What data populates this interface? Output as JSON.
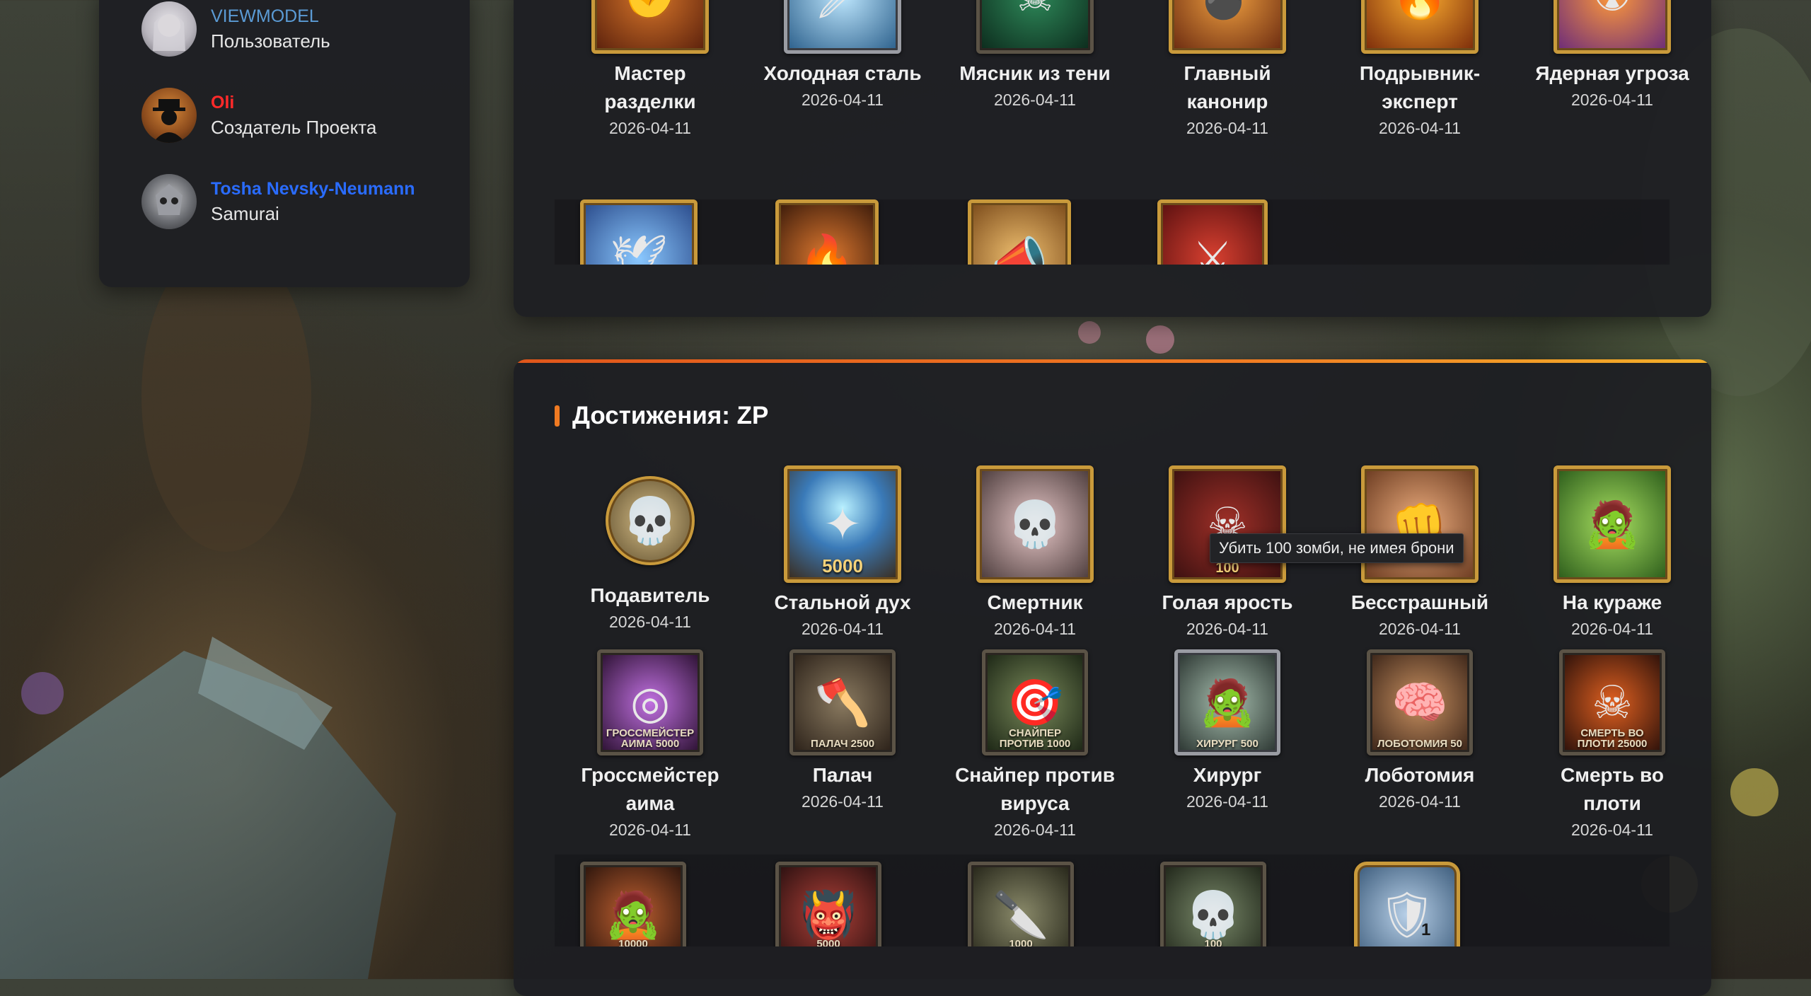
{
  "sidebar": {
    "members": [
      {
        "name": "VIEWMODEL",
        "role": "Пользователь",
        "name_color": "#5b9bd5"
      },
      {
        "name": "Oli",
        "role": "Создатель Проекта",
        "name_color": "#ff2a2a"
      },
      {
        "name": "Tosha Nevsky-Neumann",
        "role": "Samurai",
        "name_color": "#2a6cff"
      }
    ]
  },
  "top_section": {
    "achievements": [
      {
        "name_line1": "Мастер",
        "name_line2": "разделки",
        "date": "2026-04-11",
        "icon": "butcher-fist-icon"
      },
      {
        "name_line1": "Холодная сталь",
        "name_line2": "",
        "date": "2026-04-11",
        "icon": "ice-knife-icon"
      },
      {
        "name_line1": "Мясник из тени",
        "name_line2": "",
        "date": "2026-04-11",
        "icon": "shadow-reaper-icon"
      },
      {
        "name_line1": "Главный",
        "name_line2": "канонир",
        "date": "2026-04-11",
        "icon": "cannon-bombs-icon"
      },
      {
        "name_line1": "Подрывник-",
        "name_line2": "эксперт",
        "date": "2026-04-11",
        "icon": "explosion-bombs-icon"
      },
      {
        "name_line1": "Ядерная угроза",
        "name_line2": "",
        "date": "2026-04-11",
        "icon": "nuke-cloud-icon"
      }
    ],
    "partial_row_icons": [
      "dove-icon",
      "fire-figure-icon",
      "megaphone-icon",
      "crossed-swords-skull-icon"
    ]
  },
  "zp_section": {
    "title": "Достижения: ZP",
    "achievements_row1": [
      {
        "name_line1": "Подавитель",
        "name_line2": "",
        "date": "2026-04-11",
        "icon": "skull-axe-icon",
        "badge_text": ""
      },
      {
        "name_line1": "Стальной дух",
        "name_line2": "",
        "date": "2026-04-11",
        "icon": "spirit-glow-icon",
        "badge_text": "5000"
      },
      {
        "name_line1": "Смертник",
        "name_line2": "",
        "date": "2026-04-11",
        "icon": "cyber-skull-icon",
        "badge_text": ""
      },
      {
        "name_line1": "Голая ярость",
        "name_line2": "",
        "date": "2026-04-11",
        "icon": "skulls-shield-icon",
        "badge_text": "100"
      },
      {
        "name_line1": "Бесстрашный",
        "name_line2": "",
        "date": "2026-04-11",
        "icon": "fist-zombie-icon",
        "badge_text": ""
      },
      {
        "name_line1": "На кураже",
        "name_line2": "",
        "date": "2026-04-11",
        "icon": "zombie-kick-icon",
        "badge_text": ""
      }
    ],
    "achievements_row2": [
      {
        "name_line1": "Гроссмейстер",
        "name_line2": "аима",
        "date": "2026-04-11",
        "icon": "crosshair-eye-icon",
        "badge_text": "ГРОССМЕЙСТЕР АИМА 5000"
      },
      {
        "name_line1": "Палач",
        "name_line2": "",
        "date": "2026-04-11",
        "icon": "executioner-icon",
        "badge_text": "ПАЛАЧ 2500"
      },
      {
        "name_line1": "Снайпер против",
        "name_line2": "вируса",
        "date": "2026-04-11",
        "icon": "sniper-zombie-icon",
        "badge_text": "СНАЙПЕР ПРОТИВ 1000"
      },
      {
        "name_line1": "Хирург",
        "name_line2": "",
        "date": "2026-04-11",
        "icon": "surgeon-zombie-icon",
        "badge_text": "ХИРУРГ 500"
      },
      {
        "name_line1": "Лоботомия",
        "name_line2": "",
        "date": "2026-04-11",
        "icon": "lobotomy-brain-icon",
        "badge_text": "ЛОБОТОМИЯ 50"
      },
      {
        "name_line1": "Смерть во",
        "name_line2": "плоти",
        "date": "2026-04-11",
        "icon": "reaper-fire-icon",
        "badge_text": "СМЕРТЬ ВО ПЛОТИ 25000"
      }
    ],
    "partial_row": [
      {
        "icon": "apocalypse-walker-icon",
        "badge_text": "10000"
      },
      {
        "icon": "demon-skull-icon",
        "badge_text": "5000"
      },
      {
        "icon": "cleaner-knife-icon",
        "badge_text": "1000"
      },
      {
        "icon": "hunter-skull-icon",
        "badge_text": "100"
      },
      {
        "icon": "body-shield-icon",
        "badge_text": "1"
      }
    ],
    "tooltip": "Убить 100 зомби, не имея брони"
  }
}
